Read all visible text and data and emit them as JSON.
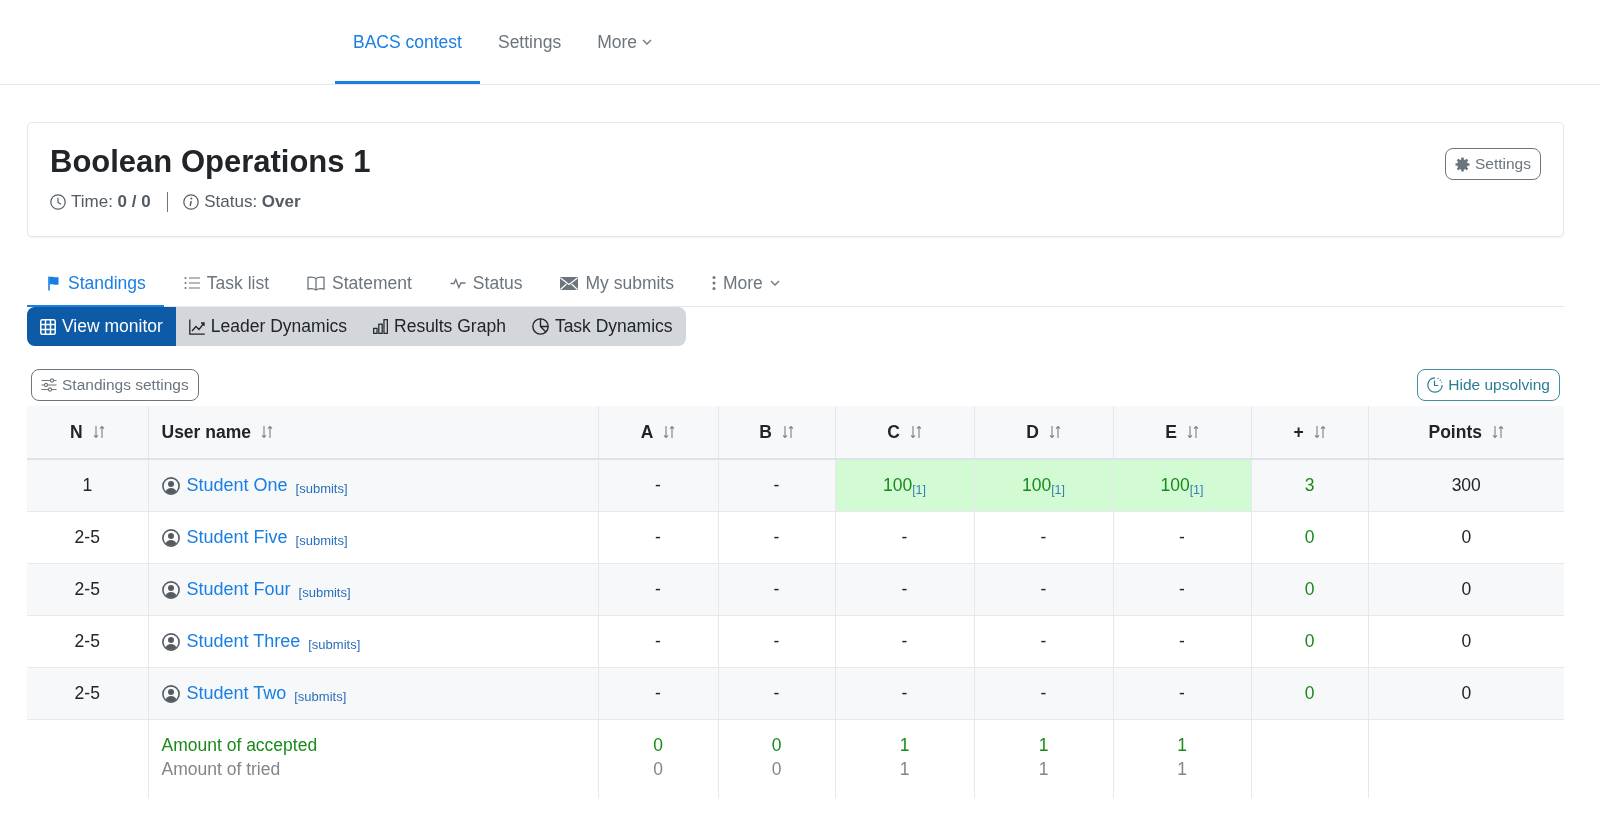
{
  "top_nav": [
    {
      "label": "BACS contest",
      "selected": true,
      "kind": "link"
    },
    {
      "label": "Settings",
      "selected": false,
      "kind": "link"
    },
    {
      "label": "More",
      "selected": false,
      "kind": "dropdown"
    }
  ],
  "contest": {
    "title": "Boolean Operations 1",
    "time": "Time: **0 / 0**",
    "status": "Status: **Over**",
    "settings_button": "Settings"
  },
  "tabs": [
    {
      "label": "Standings",
      "selected": true,
      "kind": "link"
    },
    {
      "label": "Task list",
      "selected": false,
      "kind": "link"
    },
    {
      "label": "Statement",
      "selected": false,
      "kind": "link"
    },
    {
      "label": "Status",
      "selected": false,
      "kind": "link"
    },
    {
      "label": "My submits",
      "selected": false,
      "kind": "link"
    },
    {
      "label": "More",
      "selected": false,
      "kind": "dropdown"
    }
  ],
  "view_tabs": [
    {
      "label": "View monitor",
      "selected": true
    },
    {
      "label": "Leader Dynamics",
      "selected": false
    },
    {
      "label": "Results Graph",
      "selected": false
    },
    {
      "label": "Task Dynamics",
      "selected": false
    }
  ],
  "standings_settings_button": "Standings settings",
  "hide_upsolving_button": "Hide upsolving",
  "table": {
    "columns": [
      "N",
      "User name",
      "A",
      "B",
      "C",
      "D",
      "E",
      "+",
      "Points"
    ],
    "rows": [
      {
        "rank": "1",
        "user": "Student One",
        "submits": "[submits]",
        "problems": [
          {
            "value": "-",
            "accepted": false
          },
          {
            "value": "-",
            "accepted": false
          },
          {
            "value": "100",
            "attempts": "[1]",
            "accepted": true
          },
          {
            "value": "100",
            "attempts": "[1]",
            "accepted": true
          },
          {
            "value": "100",
            "attempts": "[1]",
            "accepted": true
          }
        ],
        "plus": "3",
        "points": "300"
      },
      {
        "rank": "2-5",
        "user": "Student Five",
        "submits": "[submits]",
        "problems": [
          {
            "value": "-",
            "accepted": false
          },
          {
            "value": "-",
            "accepted": false
          },
          {
            "value": "-",
            "accepted": false
          },
          {
            "value": "-",
            "accepted": false
          },
          {
            "value": "-",
            "accepted": false
          }
        ],
        "plus": "0",
        "points": "0"
      },
      {
        "rank": "2-5",
        "user": "Student Four",
        "submits": "[submits]",
        "problems": [
          {
            "value": "-",
            "accepted": false
          },
          {
            "value": "-",
            "accepted": false
          },
          {
            "value": "-",
            "accepted": false
          },
          {
            "value": "-",
            "accepted": false
          },
          {
            "value": "-",
            "accepted": false
          }
        ],
        "plus": "0",
        "points": "0"
      },
      {
        "rank": "2-5",
        "user": "Student Three",
        "submits": "[submits]",
        "problems": [
          {
            "value": "-",
            "accepted": false
          },
          {
            "value": "-",
            "accepted": false
          },
          {
            "value": "-",
            "accepted": false
          },
          {
            "value": "-",
            "accepted": false
          },
          {
            "value": "-",
            "accepted": false
          }
        ],
        "plus": "0",
        "points": "0"
      },
      {
        "rank": "2-5",
        "user": "Student Two",
        "submits": "[submits]",
        "problems": [
          {
            "value": "-",
            "accepted": false
          },
          {
            "value": "-",
            "accepted": false
          },
          {
            "value": "-",
            "accepted": false
          },
          {
            "value": "-",
            "accepted": false
          },
          {
            "value": "-",
            "accepted": false
          }
        ],
        "plus": "0",
        "points": "0"
      }
    ],
    "footer": {
      "accepted_label": "Amount of accepted",
      "tried_label": "Amount of tried",
      "accepted_counts": [
        "0",
        "0",
        "1",
        "1",
        "1"
      ],
      "tried_counts": [
        "0",
        "0",
        "1",
        "1",
        "1"
      ]
    }
  }
}
